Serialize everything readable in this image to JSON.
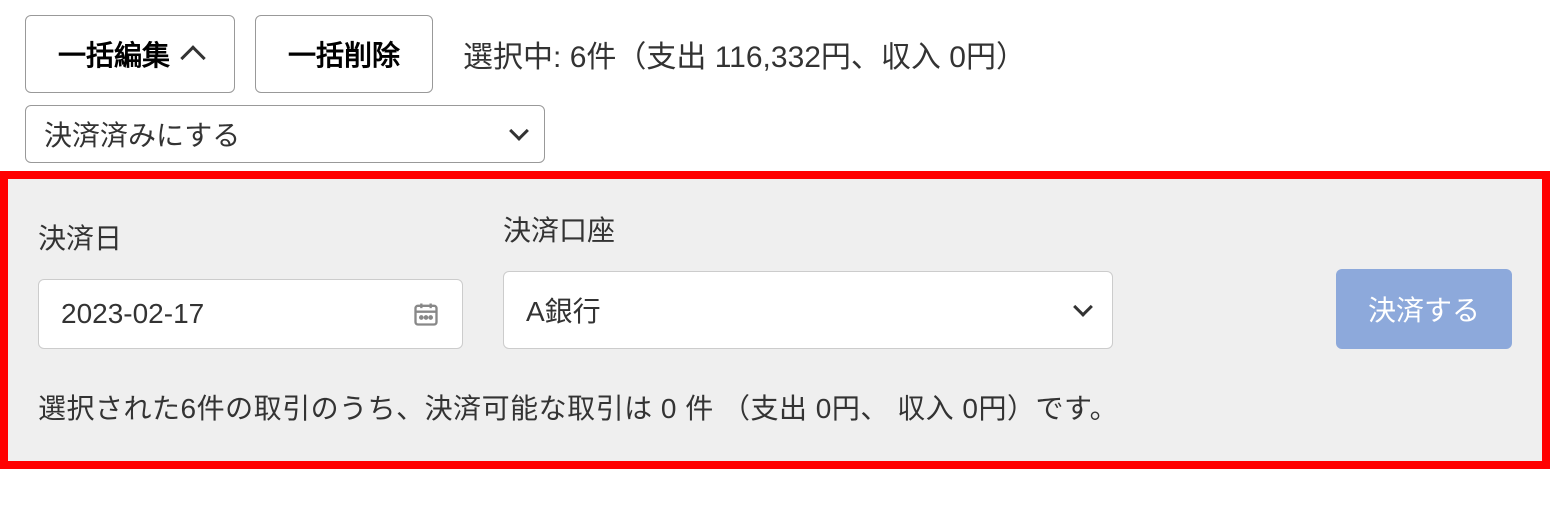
{
  "toolbar": {
    "bulk_edit_label": "一括編集",
    "bulk_delete_label": "一括削除",
    "selection_summary": "選択中: 6件（支出 116,332円、収入 0円）"
  },
  "action_select": {
    "value": "決済済みにする"
  },
  "panel": {
    "date_label": "決済日",
    "date_value": "2023-02-17",
    "account_label": "決済口座",
    "account_value": "A銀行",
    "settle_button": "決済する",
    "note": "選択された6件の取引のうち、決済可能な取引は 0 件 （支出 0円、 収入 0円）です。"
  }
}
